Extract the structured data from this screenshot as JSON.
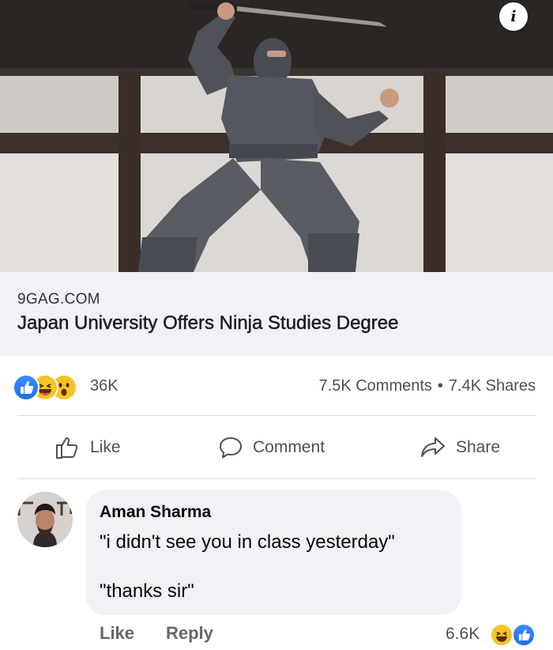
{
  "preview": {
    "image_alt": "ninja",
    "info_icon": "info-icon",
    "info_label": "i",
    "domain": "9GAG.COM",
    "headline": "Japan University Offers Ninja Studies Degree"
  },
  "stats": {
    "reaction_icons": [
      "like-reaction-icon",
      "haha-reaction-icon",
      "wow-reaction-icon"
    ],
    "reaction_count": "36K",
    "comments": "7.5K Comments",
    "separator": "•",
    "shares": "7.4K Shares"
  },
  "actions": {
    "like": "Like",
    "comment": "Comment",
    "share": "Share"
  },
  "comment": {
    "author": "Aman Sharma",
    "line1": "\"i didn't see you in class yesterday\"",
    "line2": "\"thanks sir\"",
    "like": "Like",
    "reply": "Reply",
    "reaction_count": "6.6K",
    "reaction_icons": [
      "haha-reaction-icon",
      "like-reaction-icon"
    ]
  },
  "colors": {
    "like_blue": "#1b6ff5",
    "reaction_yellow": "#f7c325",
    "caption_bg": "#f0f2f5",
    "muted_text": "#65676b"
  }
}
